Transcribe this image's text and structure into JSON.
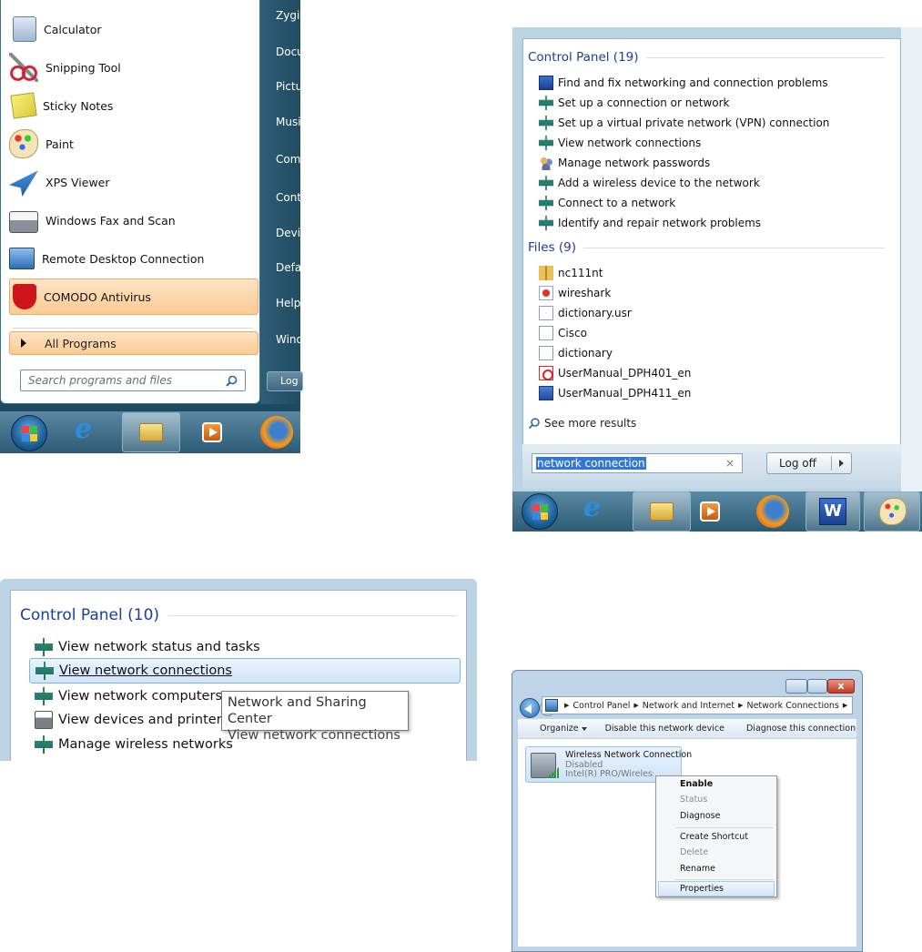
{
  "start_menu": {
    "items": [
      {
        "label": "Calculator",
        "icon": "calculator-icon"
      },
      {
        "label": "Snipping Tool",
        "icon": "scissors-icon"
      },
      {
        "label": "Sticky Notes",
        "icon": "sticky-notes-icon"
      },
      {
        "label": "Paint",
        "icon": "paint-palette-icon"
      },
      {
        "label": "XPS Viewer",
        "icon": "xps-viewer-icon"
      },
      {
        "label": "Windows Fax and Scan",
        "icon": "fax-icon"
      },
      {
        "label": "Remote Desktop Connection",
        "icon": "remote-desktop-icon"
      },
      {
        "label": "COMODO Antivirus",
        "icon": "comodo-shield-icon"
      }
    ],
    "all_programs": "All Programs",
    "search_placeholder": "Search programs and files",
    "right_items": [
      "Zygi",
      "Docu",
      "Pictu",
      "Musi",
      "Com",
      "Cont",
      "Devi",
      "Defa",
      "Help",
      "Wind"
    ],
    "logoff_partial": "Log"
  },
  "search_panel": {
    "control_panel_header": "Control Panel (19)",
    "control_panel_items": [
      "Find and fix networking and connection problems",
      "Set up a connection or network",
      "Set up a virtual private network (VPN) connection",
      "View network connections",
      "Manage network passwords",
      "Add a wireless device to the network",
      "Connect to a network",
      "Identify and repair network problems"
    ],
    "files_header": "Files (9)",
    "files": [
      {
        "name": "nc111nt",
        "icon": "zip-folder-icon"
      },
      {
        "name": "wireshark",
        "icon": "wireshark-icon"
      },
      {
        "name": "dictionary.usr",
        "icon": "blank-file-icon"
      },
      {
        "name": "Cisco",
        "icon": "config-file-icon"
      },
      {
        "name": "dictionary",
        "icon": "config-file-icon"
      },
      {
        "name": "UserManual_DPH401_en",
        "icon": "pdf-icon"
      },
      {
        "name": "UserManual_DPH411_en",
        "icon": "word-doc-icon"
      }
    ],
    "see_more": "See more results",
    "search_value": "network connection",
    "clear_glyph": "×",
    "logoff_label": "Log off"
  },
  "control_panel_zoom": {
    "header": "Control Panel (10)",
    "items": [
      "View network status and tasks",
      "View network connections",
      "View network computers a",
      "View devices and printers",
      "Manage wireless networks"
    ],
    "tooltip_line1": "Network and Sharing Center",
    "tooltip_line2": "View network connections"
  },
  "network_connections": {
    "close_glyph": "x",
    "breadcrumbs": [
      "Control Panel",
      "Network and Internet",
      "Network Connections"
    ],
    "toolbar": {
      "organize": "Organize",
      "disable": "Disable this network device",
      "diagnose": "Diagnose this connection"
    },
    "connection": {
      "name": "Wireless Network Connection",
      "status": "Disabled",
      "adapter": "Intel(R) PRO/Wireless 39454"
    },
    "context_menu": [
      "Enable",
      "Status",
      "Diagnose",
      "Create Shortcut",
      "Delete",
      "Rename",
      "Properties"
    ]
  }
}
